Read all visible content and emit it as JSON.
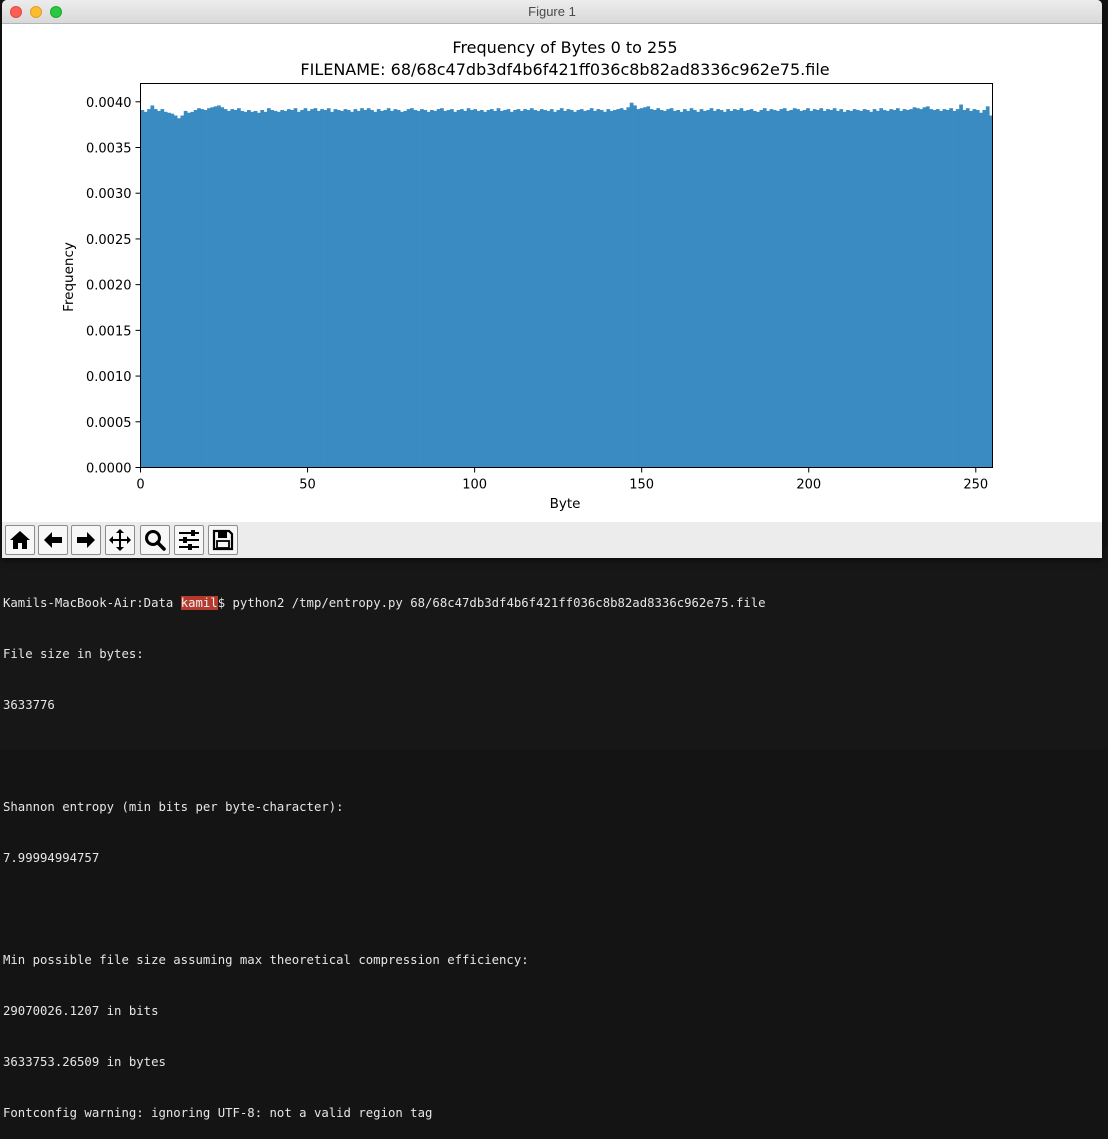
{
  "window": {
    "title": "Figure 1"
  },
  "toolbar": {
    "buttons": [
      {
        "name": "home-button",
        "icon": "home-icon"
      },
      {
        "name": "back-button",
        "icon": "arrow-left-icon"
      },
      {
        "name": "forward-button",
        "icon": "arrow-right-icon"
      },
      {
        "name": "pan-button",
        "icon": "move-icon"
      },
      {
        "name": "zoom-button",
        "icon": "magnifier-icon"
      },
      {
        "name": "configure-subplots-button",
        "icon": "sliders-icon"
      },
      {
        "name": "save-button",
        "icon": "floppy-disk-icon"
      }
    ]
  },
  "chart_data": {
    "type": "bar",
    "title": "Frequency of Bytes 0 to 255",
    "subtitle": "FILENAME: 68/68c47db3df4b6f421ff036c8b82ad8336c962e75.file",
    "xlabel": "Byte",
    "ylabel": "Frequency",
    "xlim": [
      0,
      255
    ],
    "ylim": [
      0.0,
      0.0042
    ],
    "xticks": [
      "0",
      "50",
      "100",
      "150",
      "200",
      "250"
    ],
    "yticks": [
      "0.0000",
      "0.0005",
      "0.0010",
      "0.0015",
      "0.0020",
      "0.0025",
      "0.0030",
      "0.0035",
      "0.0040"
    ],
    "bar_color": "#3a8bc2",
    "grid": false,
    "values": [
      0.00391,
      0.00389,
      0.00392,
      0.00396,
      0.00392,
      0.0039,
      0.00392,
      0.00389,
      0.00388,
      0.00387,
      0.00385,
      0.00382,
      0.00385,
      0.0039,
      0.00388,
      0.00389,
      0.00391,
      0.00393,
      0.00392,
      0.00391,
      0.00393,
      0.00394,
      0.00395,
      0.00396,
      0.00394,
      0.00392,
      0.0039,
      0.00392,
      0.00391,
      0.00393,
      0.0039,
      0.00389,
      0.00391,
      0.00389,
      0.0039,
      0.00388,
      0.00391,
      0.00389,
      0.00393,
      0.00391,
      0.0039,
      0.00389,
      0.00391,
      0.0039,
      0.00392,
      0.00391,
      0.00393,
      0.00389,
      0.00391,
      0.00393,
      0.0039,
      0.00392,
      0.00393,
      0.0039,
      0.00392,
      0.00391,
      0.00393,
      0.00389,
      0.00392,
      0.00391,
      0.0039,
      0.00392,
      0.00391,
      0.00389,
      0.00392,
      0.0039,
      0.00393,
      0.00391,
      0.00393,
      0.00391,
      0.00389,
      0.00392,
      0.0039,
      0.00391,
      0.00393,
      0.0039,
      0.00392,
      0.00391,
      0.00389,
      0.0039,
      0.00392,
      0.00393,
      0.00391,
      0.0039,
      0.00392,
      0.00391,
      0.00389,
      0.00391,
      0.0039,
      0.00392,
      0.00393,
      0.0039,
      0.00391,
      0.00392,
      0.00389,
      0.00391,
      0.00392,
      0.0039,
      0.00393,
      0.00391,
      0.00392,
      0.0039,
      0.00391,
      0.00389,
      0.00391,
      0.00392,
      0.0039,
      0.00393,
      0.0039,
      0.00391,
      0.00392,
      0.00389,
      0.00391,
      0.00392,
      0.0039,
      0.00392,
      0.00391,
      0.00393,
      0.00391,
      0.0039,
      0.00392,
      0.00391,
      0.0039,
      0.00392,
      0.00389,
      0.00391,
      0.00393,
      0.0039,
      0.00392,
      0.00391,
      0.00389,
      0.00391,
      0.00392,
      0.0039,
      0.00391,
      0.00393,
      0.0039,
      0.00392,
      0.00391,
      0.00389,
      0.00392,
      0.0039,
      0.00391,
      0.00392,
      0.00393,
      0.00391,
      0.00394,
      0.00399,
      0.00396,
      0.00392,
      0.00393,
      0.00394,
      0.00395,
      0.00392,
      0.00391,
      0.00393,
      0.00391,
      0.0039,
      0.00392,
      0.00393,
      0.0039,
      0.00391,
      0.00389,
      0.00392,
      0.0039,
      0.00393,
      0.00391,
      0.00389,
      0.00392,
      0.0039,
      0.00391,
      0.00393,
      0.0039,
      0.00392,
      0.00391,
      0.00389,
      0.00392,
      0.0039,
      0.00392,
      0.00391,
      0.00393,
      0.0039,
      0.00391,
      0.00392,
      0.0039,
      0.00389,
      0.00391,
      0.00393,
      0.0039,
      0.00392,
      0.00391,
      0.0039,
      0.00392,
      0.00393,
      0.0039,
      0.00391,
      0.00393,
      0.00392,
      0.0039,
      0.00391,
      0.00393,
      0.0039,
      0.00392,
      0.00391,
      0.00393,
      0.0039,
      0.00392,
      0.00391,
      0.00393,
      0.0039,
      0.00392,
      0.00389,
      0.00391,
      0.0039,
      0.00392,
      0.00391,
      0.0039,
      0.00392,
      0.00391,
      0.00389,
      0.00392,
      0.0039,
      0.00393,
      0.00391,
      0.0039,
      0.00392,
      0.00391,
      0.00393,
      0.0039,
      0.00392,
      0.00391,
      0.00392,
      0.00394,
      0.00393,
      0.00392,
      0.00394,
      0.00395,
      0.00392,
      0.00391,
      0.00392,
      0.0039,
      0.00392,
      0.00391,
      0.00393,
      0.0039,
      0.00392,
      0.00397,
      0.00391,
      0.00393,
      0.0039,
      0.00392,
      0.00391,
      0.00388,
      0.00391,
      0.00395,
      0.00385
    ]
  },
  "terminal": {
    "prompt_host": "Kamils-MacBook-Air:Data ",
    "prompt_user": "kamil",
    "prompt_command": "$ python2 /tmp/entropy.py 68/68c47db3df4b6f421ff036c8b82ad8336c962e75.file",
    "lines": [
      "File size in bytes:",
      "3633776",
      "",
      "Shannon entropy (min bits per byte-character):",
      "7.99994994757",
      "",
      "Min possible file size assuming max theoretical compression efficiency:",
      "29070026.1207 in bits",
      "3633753.26509 in bytes",
      "Fontconfig warning: ignoring UTF-8: not a valid region tag"
    ]
  }
}
